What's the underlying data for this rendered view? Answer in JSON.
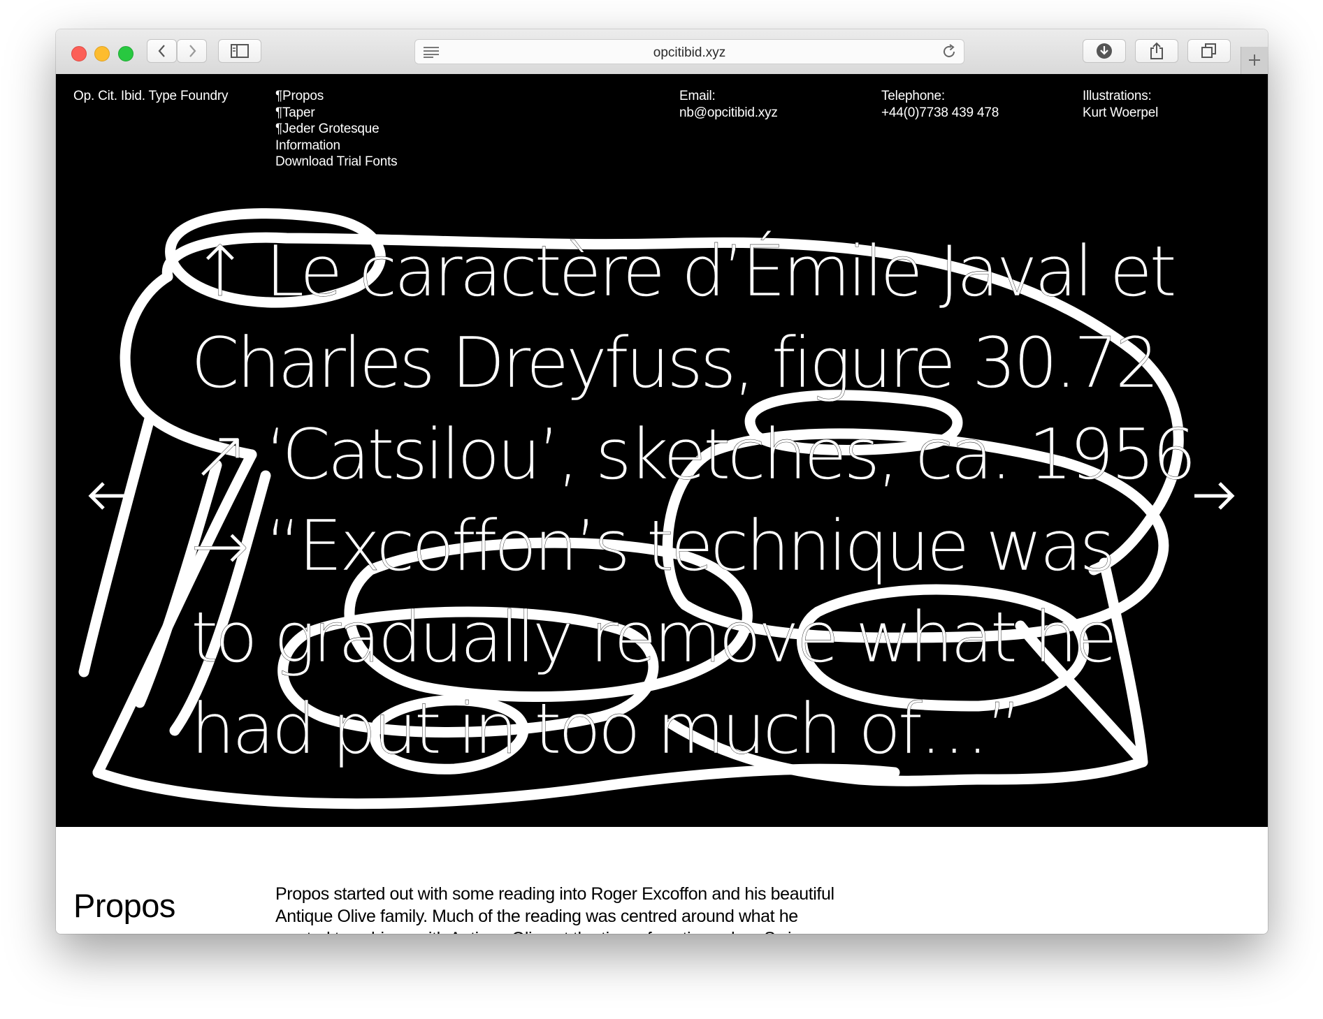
{
  "browser": {
    "url": "opcitibid.xyz"
  },
  "header": {
    "brand": "Op. Cit. Ibid. Type Foundry",
    "nav": [
      {
        "label": "¶Propos"
      },
      {
        "label": "¶Taper"
      },
      {
        "label": "¶Jeder Grotesque"
      },
      {
        "label": "Information"
      },
      {
        "label": "Download Trial Fonts"
      }
    ],
    "email_label": "Email:",
    "email_value": "nb@opcitibid.xyz",
    "telephone_label": "Telephone:",
    "telephone_value": "+44(0)7738 439 478",
    "illustrations_label": "Illustrations:",
    "illustrations_value": "Kurt Woerpel"
  },
  "hero": {
    "lines": [
      "↑ Le caractère d’Émile Javal et",
      "Charles Dreyfuss, figure 30.72",
      "↗ ‘Catsilou’, sketches, ca. 1956",
      "→ “Excoffon’s technique was",
      "to gradually remove what he",
      "had put in too much of…”"
    ],
    "prev_icon": "arrow-left-icon",
    "next_icon": "arrow-right-icon"
  },
  "section": {
    "title": "Propos",
    "body_lines": [
      "Propos started out with some reading into Roger Excoffon and his beautiful",
      "Antique Olive family. Much of the reading was centred around what he",
      "wanted to achieve with Antique Olive at the time of casting, when Swiss"
    ]
  },
  "colors": {
    "hero_background": "#000000",
    "hero_text": "#ffffff",
    "page_background": "#ffffff"
  }
}
